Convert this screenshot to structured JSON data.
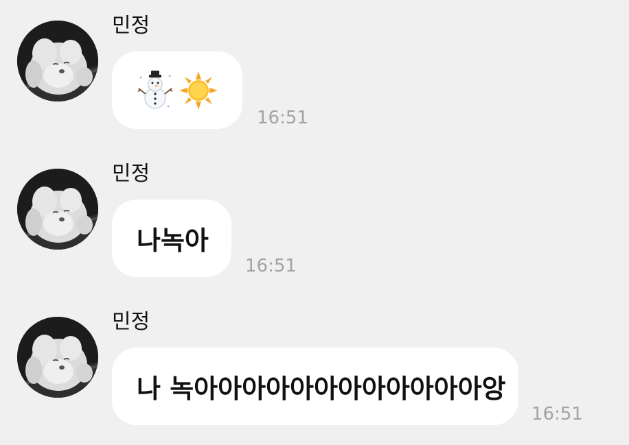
{
  "messages": [
    {
      "sender": "민정",
      "type": "emoji",
      "content": "",
      "emojis": [
        "snowman-icon",
        "sun-icon"
      ],
      "time": "16:51"
    },
    {
      "sender": "민정",
      "type": "text",
      "content": "나녹아",
      "time": "16:51"
    },
    {
      "sender": "민정",
      "type": "text",
      "content": "나 녹아아아아아아아아아아아아앙",
      "time": "16:51"
    }
  ],
  "colors": {
    "background": "#f0f0f0",
    "bubble": "#ffffff",
    "timestamp": "#a3a3a3"
  }
}
